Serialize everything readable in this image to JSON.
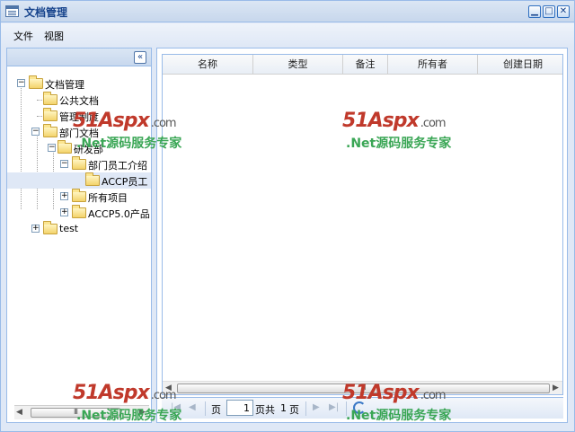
{
  "window": {
    "title": "文档管理",
    "min_label": "▁",
    "max_label": "□",
    "close_label": "✕"
  },
  "menu": {
    "items": [
      {
        "label": "文件"
      },
      {
        "label": "视图"
      }
    ]
  },
  "west": {
    "collapse_label": "«",
    "tree": [
      {
        "label": "文档管理",
        "expanded": true
      },
      {
        "label": "公共文档"
      },
      {
        "label": "管理制度"
      },
      {
        "label": "部门文档",
        "expanded": true
      },
      {
        "label": "研发部",
        "expanded": true
      },
      {
        "label": "部门员工介绍",
        "expanded": true
      },
      {
        "label": "ACCP员工",
        "selected": true
      },
      {
        "label": "所有项目",
        "expanded": false
      },
      {
        "label": "ACCP5.0产品",
        "expanded": false
      },
      {
        "label": "test",
        "expanded": false
      }
    ],
    "scroll_thumb": "III"
  },
  "grid": {
    "columns": [
      "名称",
      "类型",
      "备注",
      "所有者",
      "创建日期"
    ],
    "rows": [],
    "scroll_thumb": "III"
  },
  "paging": {
    "page_label": "页",
    "current_page": "1",
    "total_prefix": "页共",
    "total_pages": "1",
    "total_suffix": "页"
  },
  "watermark": {
    "logo_main": "51Aspx",
    "logo_domain": ".com",
    "tagline": ".Net源码服务专家"
  }
}
